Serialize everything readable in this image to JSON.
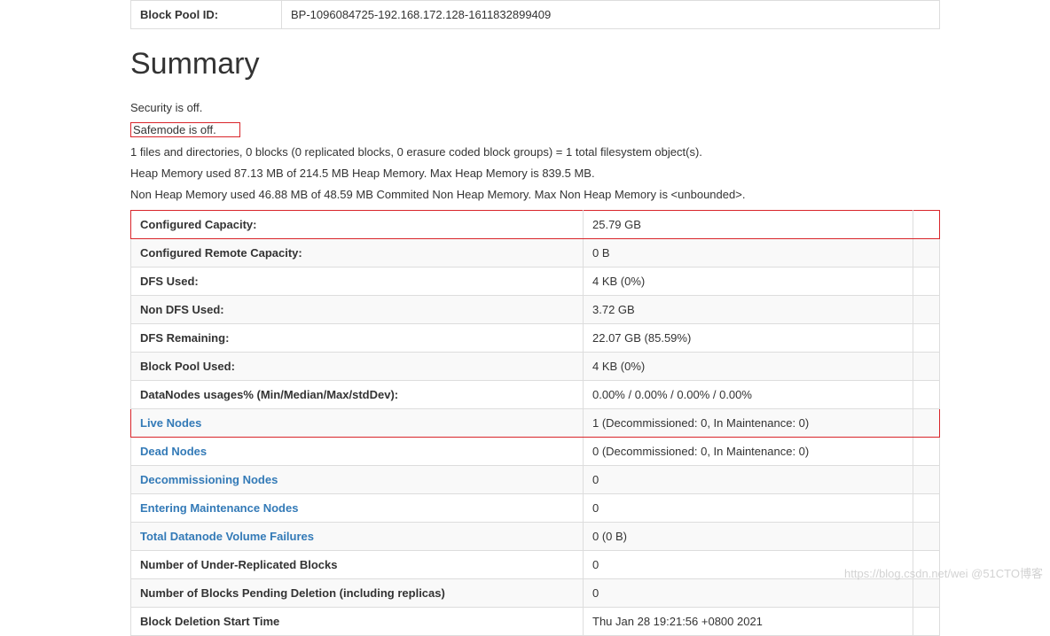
{
  "blockPool": {
    "label": "Block Pool ID:",
    "value": "BP-1096084725-192.168.172.128-1611832899409"
  },
  "summary": {
    "title": "Summary",
    "security": "Security is off.",
    "safemode": "Safemode is off.",
    "filesystem": "1 files and directories, 0 blocks (0 replicated blocks, 0 erasure coded block groups) = 1 total filesystem object(s).",
    "heap": "Heap Memory used 87.13 MB of 214.5 MB Heap Memory. Max Heap Memory is 839.5 MB.",
    "nonheap": "Non Heap Memory used 46.88 MB of 48.59 MB Commited Non Heap Memory. Max Non Heap Memory is <unbounded>."
  },
  "rows": [
    {
      "k": "Configured Capacity:",
      "v": "25.79 GB",
      "link": false,
      "hl": true
    },
    {
      "k": "Configured Remote Capacity:",
      "v": "0 B",
      "link": false,
      "hl": false
    },
    {
      "k": "DFS Used:",
      "v": "4 KB (0%)",
      "link": false,
      "hl": false
    },
    {
      "k": "Non DFS Used:",
      "v": "3.72 GB",
      "link": false,
      "hl": false
    },
    {
      "k": "DFS Remaining:",
      "v": "22.07 GB (85.59%)",
      "link": false,
      "hl": false
    },
    {
      "k": "Block Pool Used:",
      "v": "4 KB (0%)",
      "link": false,
      "hl": false
    },
    {
      "k": "DataNodes usages% (Min/Median/Max/stdDev):",
      "v": "0.00% / 0.00% / 0.00% / 0.00%",
      "link": false,
      "hl": false
    },
    {
      "k": "Live Nodes",
      "v": "1 (Decommissioned: 0, In Maintenance: 0)",
      "link": true,
      "hl": true
    },
    {
      "k": "Dead Nodes",
      "v": "0 (Decommissioned: 0, In Maintenance: 0)",
      "link": true,
      "hl": false
    },
    {
      "k": "Decommissioning Nodes",
      "v": "0",
      "link": true,
      "hl": false
    },
    {
      "k": "Entering Maintenance Nodes",
      "v": "0",
      "link": true,
      "hl": false
    },
    {
      "k": "Total Datanode Volume Failures",
      "v": "0 (0 B)",
      "link": true,
      "hl": false
    },
    {
      "k": "Number of Under-Replicated Blocks",
      "v": "0",
      "link": false,
      "hl": false
    },
    {
      "k": "Number of Blocks Pending Deletion (including replicas)",
      "v": "0",
      "link": false,
      "hl": false
    },
    {
      "k": "Block Deletion Start Time",
      "v": "Thu Jan 28 19:21:56 +0800 2021",
      "link": false,
      "hl": false
    }
  ],
  "watermark": "https://blog.csdn.net/wei  @51CTO博客"
}
